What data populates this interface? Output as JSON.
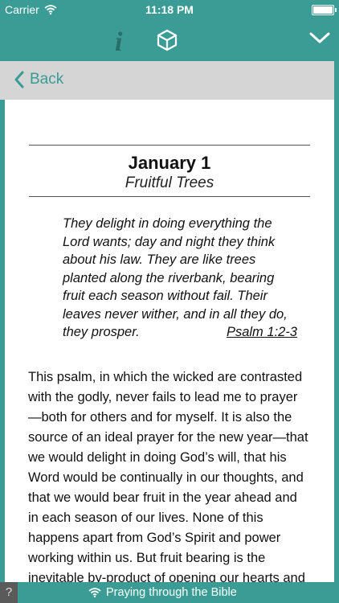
{
  "status": {
    "carrier": "Carrier",
    "time": "11:18 PM"
  },
  "toolbar": {
    "info_icon": "i",
    "icons": [
      "info-icon",
      "cube-icon",
      "chevron-down-icon"
    ]
  },
  "nav": {
    "back_label": "Back"
  },
  "devotion": {
    "date": "January 1",
    "title": "Fruitful Trees",
    "quote": "They delight in doing everything the Lord wants; day and night they think about his law. They are like trees planted along the riverbank, bearing fruit each season without fail. Their leaves never wither, and in all they do, they prosper.",
    "reference": "Psalm 1:2-3",
    "body": "This psalm, in which the wicked are contrasted with the godly, never fails to lead me to prayer—both for others and for myself. It is also the source of an ideal prayer for the new year—that we would delight in doing God’s will, that his Word would be continually in our thoughts, and that we would bear fruit in the year ahead and in each season of our lives. None of this happens apart from God’s Spirit and power working within us. But fruit bearing is the inevitable by-product of opening our hearts and lives to the power of his life within us. As we abide in Christ and his"
  },
  "footer": {
    "help_label": "?",
    "title": "Praying through the Bible"
  },
  "colors": {
    "accent": "#3a9c95",
    "back_bar": "#d5d5d5"
  }
}
